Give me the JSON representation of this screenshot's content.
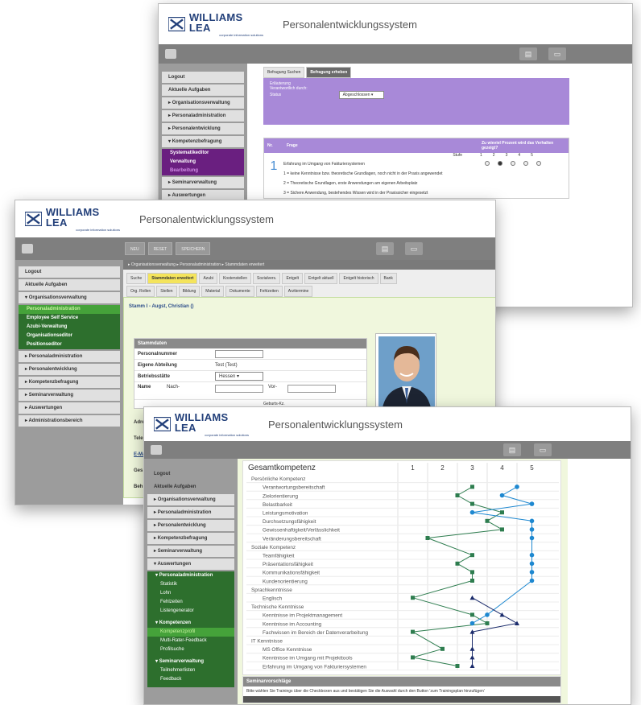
{
  "brand": {
    "logo_text": "WILLIAMS LEA",
    "logo_sub": "corporate information solutions",
    "app_title": "Personalentwicklungssystem"
  },
  "colors": {
    "logo": "#23407a",
    "purple": "#a889d8",
    "green_dark": "#2d6f2d",
    "green_active": "#45a23a",
    "tab_active": "#f4e45c",
    "line_green": "#2e7d4f",
    "line_blue": "#1e88d0",
    "line_navy": "#1a2b6b"
  },
  "icons": {
    "home": "home-icon",
    "print": "printer-icon",
    "export": "export-icon"
  },
  "back": {
    "sidebar": [
      "Logout",
      "Aktuelle Aufgaben",
      "Organisationsverwaltung",
      "Personaladministration",
      "Personalentwicklung",
      "Kompetenzbefragung"
    ],
    "sidebar_sub": [
      "Systematikeditor",
      "Verwaltung",
      "Bearbeitung"
    ],
    "sidebar_after": [
      "Seminarverwaltung",
      "Auswertungen"
    ],
    "tabs": [
      "Befragung Suchen",
      "Befragung erheben"
    ],
    "form_labels": [
      "Erläuterung",
      "Verantwortlich durch:",
      "Status"
    ],
    "status_value": "Abgeschlossen",
    "table": {
      "col_nr": "Nr.",
      "col_frage": "Frage",
      "col_prozent": "Zu wieviel Prozent wird das Verhalten gezeigt?",
      "stufe": "Stufe",
      "scale": [
        "1",
        "2",
        "3",
        "4",
        "5"
      ],
      "q_number": "1",
      "q_title": "Erfahrung im Umgang von Fakturiersystemen",
      "q_levels": [
        "1 = keine Kenntnisse bzw. theoretische Grundlagen, noch nicht in der Praxis angewendet",
        "2 = Theoretische Grundlagen, erste Anwendungen am eigenen Arbeitsplatz",
        "3 = Sichere Anwendung, bestehendes Wissen wird in der Praxissicher eingesetzt"
      ],
      "selected": 2
    }
  },
  "mid": {
    "toolbar_buttons": [
      "NEU",
      "RESET",
      "SPEICHERN"
    ],
    "sidebar": [
      "Logout",
      "Aktuelle Aufgaben",
      "Organisationsverwaltung"
    ],
    "sidebar_sub": [
      "Personaladministration",
      "Employee Self Service",
      "Azubi-Verwaltung",
      "Organisationseditor",
      "Positionseditor"
    ],
    "sidebar_after": [
      "Personaladministration",
      "Personalentwicklung",
      "Kompetenzbefragung",
      "Seminarverwaltung",
      "Auswertungen",
      "Administrationsbereich"
    ],
    "breadcrumb": "▸ Organisationsverwaltung ▸ Personaladministration ▸ Stammdaten erweitert",
    "tabs_row1": [
      "Suche",
      "Stammdaten erweitert",
      "Azubi",
      "Kostenstellen",
      "Sozialvers.",
      "Entgelt",
      "Entgelt aktuell",
      "Entgelt historisch",
      "Bank"
    ],
    "tabs_row2": [
      "Org. Rollen",
      "Stellen",
      "Bildung",
      "Material",
      "Dokumente",
      "Fehlzeiten",
      "Arzttermine"
    ],
    "employee": "Stamm I - Augst, Christian ()",
    "section": "Stammdaten",
    "fields": [
      {
        "label": "Personalnummer",
        "value": ""
      },
      {
        "label": "Eigene Abteilung",
        "value": "Test (Test)"
      },
      {
        "label": "Betriebsstätte",
        "value": "Hessen"
      }
    ],
    "name_label": "Name",
    "nach_label": "Nach-",
    "vor_label": "Vor-",
    "geburts_label": "Geburts-Kz.",
    "cut_labels": [
      "Adre",
      "Tele",
      "E-Ma",
      "Ges",
      "Beh"
    ]
  },
  "front": {
    "sidebar": [
      "Logout",
      "Aktuelle Aufgaben",
      "Organisationsverwaltung",
      "Personaladministration",
      "Personalentwicklung",
      "Kompetenzbefragung",
      "Seminarverwaltung",
      "Auswertungen"
    ],
    "groups": [
      {
        "title": "Personaladministration",
        "items": [
          "Statistik",
          "Lohn",
          "Fehlzeiten",
          "Listengenerator"
        ]
      },
      {
        "title": "Kompetenzen",
        "items": [
          "Kompetenzprofil",
          "Multi-Rater-Feedback",
          "Profilsuche"
        ]
      },
      {
        "title": "Seminarverwaltung",
        "items": [
          "Teilnehmerlisten",
          "Feedback"
        ]
      }
    ],
    "chart_title": "Gesamtkompetenz",
    "scale": [
      "1",
      "2",
      "3",
      "4",
      "5"
    ],
    "seminar_title": "Seminarvorschläge",
    "seminar_text": "Bitte wählen Sie Trainings über die Checkboxen aus und bestätigen Sie die Auswahl durch den Button 'zum Trainingsplan hinzufügen'"
  },
  "chart_data": {
    "type": "line",
    "title": "Gesamtkompetenz",
    "x_axis": [
      "1",
      "2",
      "3",
      "4",
      "5"
    ],
    "xlim": [
      1,
      5
    ],
    "orientation": "horizontal-profile",
    "rows": [
      {
        "label": "Persönliche Kompetenz",
        "category": true
      },
      {
        "label": "Verantwortungsbereitschaft",
        "green": 3,
        "blue": 4.5
      },
      {
        "label": "Zielorientierung",
        "green": 2.5,
        "blue": 4
      },
      {
        "label": "Belastbarkeit",
        "green": 3,
        "blue": 5
      },
      {
        "label": "Leistungsmotivation",
        "green": 4,
        "blue": 3
      },
      {
        "label": "Durchsetzungsfähigkeit",
        "green": 3.5,
        "blue": 5
      },
      {
        "label": "Gewissenhaftigkeit/Verlässlichkeit",
        "green": 4,
        "blue": 5
      },
      {
        "label": "Veränderungsbereitschaft",
        "green": 1.5,
        "blue": 5
      },
      {
        "label": "Soziale Kompetenz",
        "category": true
      },
      {
        "label": "Teamfähigkeit",
        "green": 3,
        "blue": 5
      },
      {
        "label": "Präsentationsfähigkeit",
        "green": 2.5,
        "blue": 5
      },
      {
        "label": "Kommunikationsfähigkeit",
        "green": 3,
        "blue": 5
      },
      {
        "label": "Kundenorientierung",
        "green": 3,
        "blue": 5
      },
      {
        "label": "Sprachkenntnisse",
        "category": true
      },
      {
        "label": "Englisch",
        "green": 1,
        "navy": 3
      },
      {
        "label": "Technische Kenntnisse",
        "category": true
      },
      {
        "label": "Kenntnisse im Projektmanagement",
        "green": 3,
        "blue": 3.5,
        "navy": 4
      },
      {
        "label": "Kenntnisse im Accounting",
        "green": 3.5,
        "blue": 3,
        "navy": 4.5
      },
      {
        "label": "Fachwissen im Bereich der Datenverarbeitung",
        "green": 1,
        "navy": 3
      },
      {
        "label": "IT Kenntnisse",
        "category": true
      },
      {
        "label": "MS Office Kenntnisse",
        "green": 2,
        "navy": 3
      },
      {
        "label": "Kenntnisse im Umgang mit Projekttools",
        "green": 1,
        "navy": 3
      },
      {
        "label": "Erfahrung im Umgang von Fakturiersystemen",
        "green": 2.5,
        "navy": 3
      }
    ]
  }
}
